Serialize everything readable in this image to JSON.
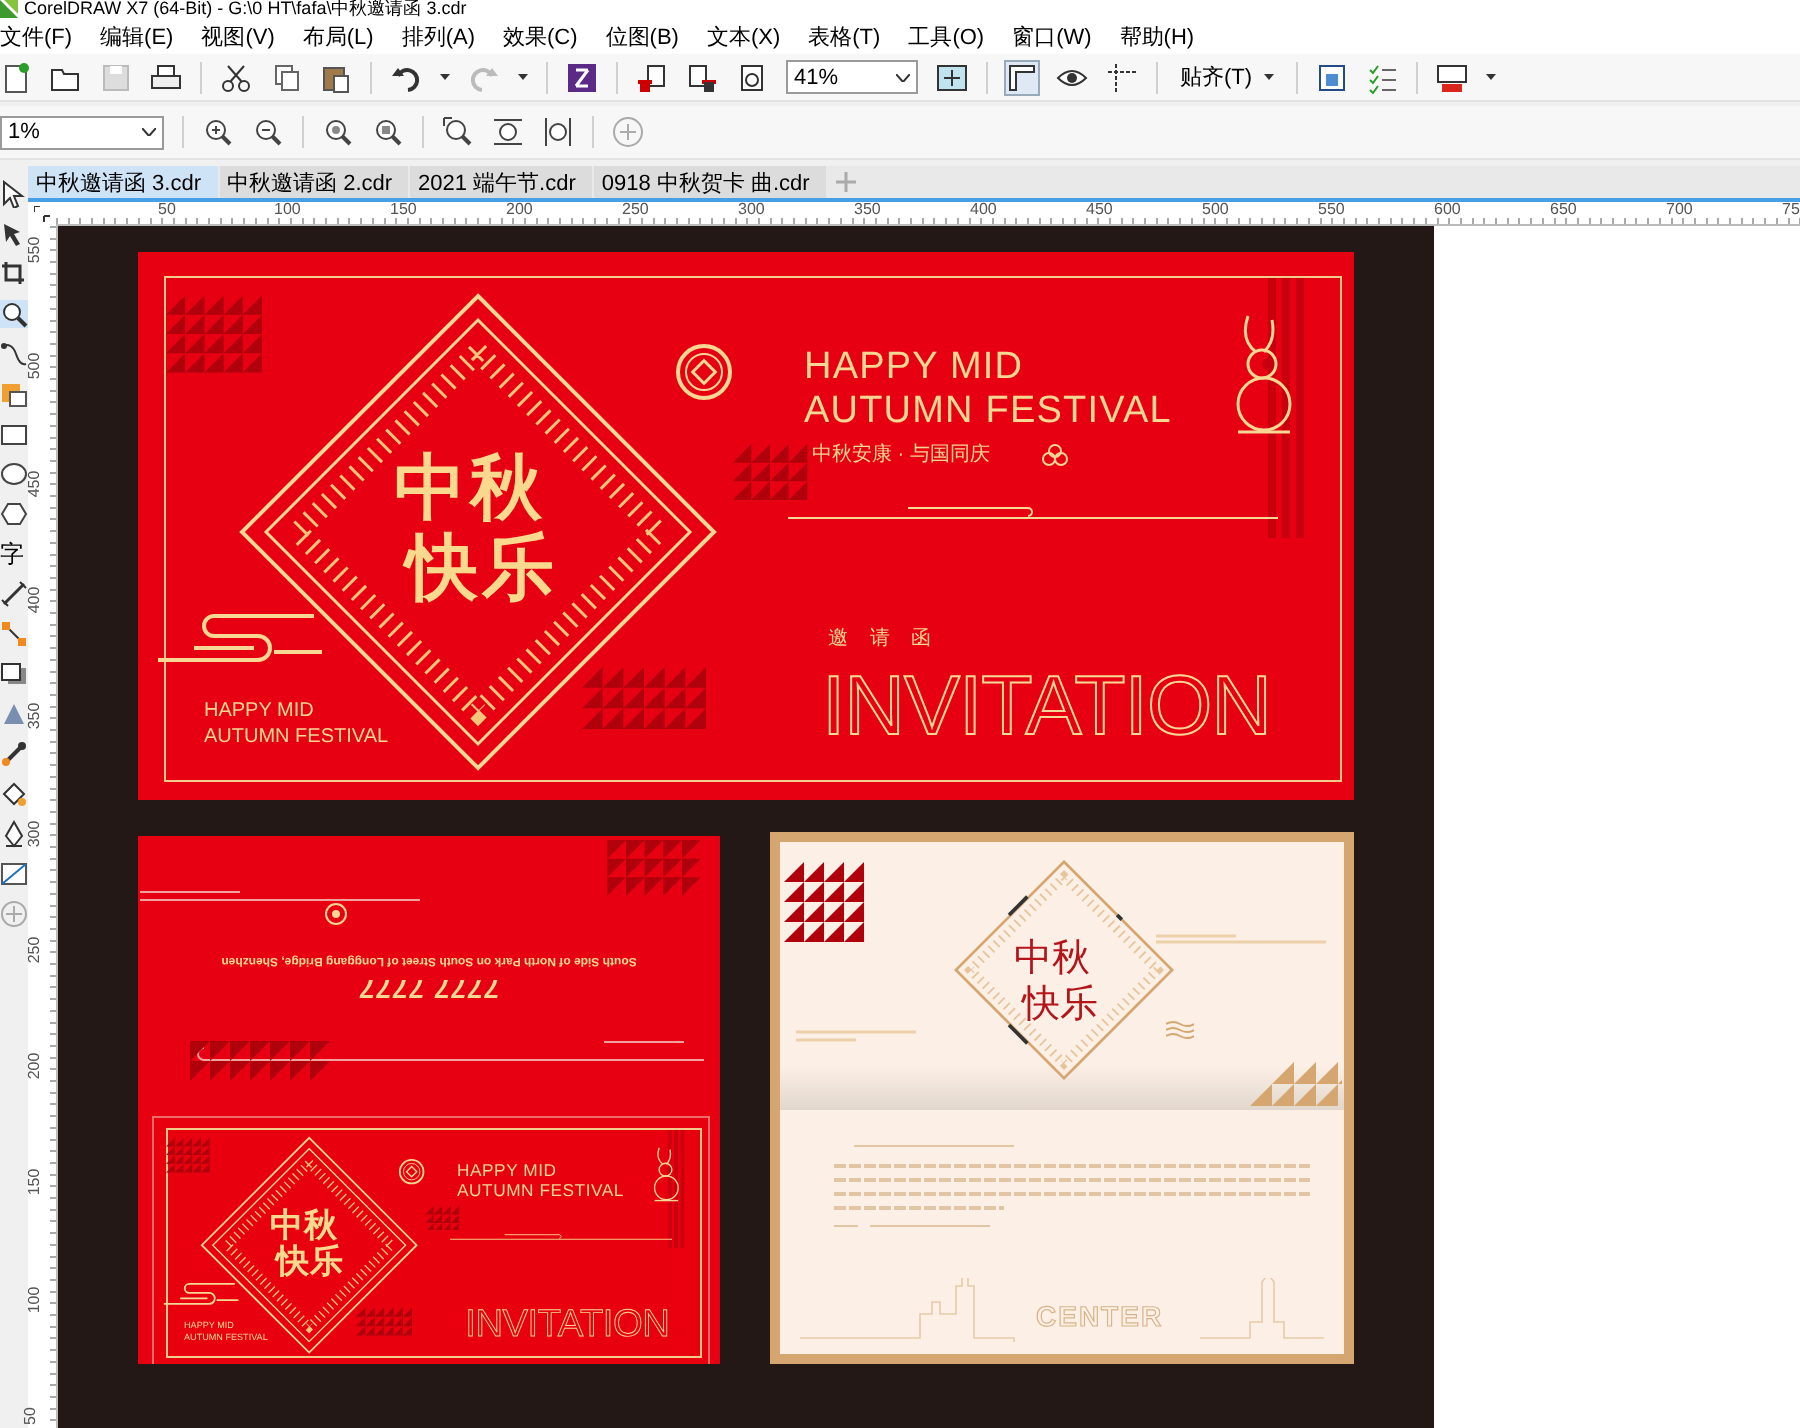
{
  "window": {
    "title": "CorelDRAW X7 (64-Bit) - G:\\0 HT\\fafa\\中秋邀请函 3.cdr"
  },
  "menu": [
    "文件(F)",
    "编辑(E)",
    "视图(V)",
    "布局(L)",
    "排列(A)",
    "效果(C)",
    "位图(B)",
    "文本(X)",
    "表格(T)",
    "工具(O)",
    "窗口(W)",
    "帮助(H)"
  ],
  "toolbar": {
    "zoom": "41%",
    "snap": "贴齐(T)"
  },
  "property_bar": {
    "zoom": "1%"
  },
  "tabs": [
    {
      "label": "中秋邀请函 3.cdr",
      "selected": true
    },
    {
      "label": "中秋邀请函 2.cdr",
      "selected": false
    },
    {
      "label": "2021 端午节.cdr",
      "selected": false
    },
    {
      "label": "0918 中秋贺卡 曲.cdr",
      "selected": false
    }
  ],
  "toolbox": {
    "text_tool": "字"
  },
  "rulers": {
    "horizontal": [
      "50",
      "100",
      "150",
      "200",
      "250",
      "300",
      "350",
      "400",
      "450",
      "500",
      "550",
      "600",
      "650",
      "700",
      "75"
    ],
    "vertical": [
      "550",
      "500",
      "450",
      "400",
      "350",
      "300",
      "250",
      "200",
      "150",
      "100",
      "50"
    ]
  },
  "artboard": {
    "cover": {
      "title": [
        "中秋",
        "快乐"
      ],
      "headline": [
        "HAPPY MID",
        "AUTUMN FESTIVAL"
      ],
      "tagline": "中秋安康 · 与国同庆",
      "invite_label": "邀 请 函",
      "invite": "INVITATION",
      "small_headline": [
        "HAPPY MID",
        "AUTUMN FESTIVAL"
      ]
    },
    "envelope": {
      "address": "South Side of North Park on South Street of Longgang Bridge, Shenzhen",
      "phone": "7777 7777",
      "cover": {
        "title": [
          "中秋",
          "快乐"
        ],
        "headline": [
          "HAPPY MID",
          "AUTUMN FESTIVAL"
        ],
        "invite": "INVITATION",
        "small_headline": [
          "HAPPY MID",
          "AUTUMN FESTIVAL"
        ]
      }
    },
    "inside": {
      "title": [
        "中秋",
        "快乐"
      ],
      "skyline_word": "CENTER"
    }
  }
}
